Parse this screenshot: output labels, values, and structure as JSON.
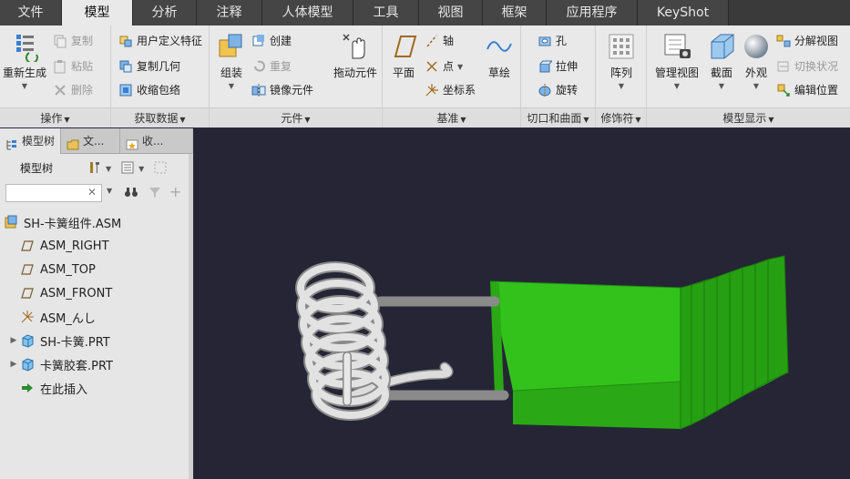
{
  "tabs": [
    "文件",
    "模型",
    "分析",
    "注释",
    "人体模型",
    "工具",
    "视图",
    "框架",
    "应用程序",
    "KeyShot"
  ],
  "active_tab": "模型",
  "ribbon": {
    "operations": {
      "label": "操作",
      "regenerate": "重新生成",
      "copy": "复制",
      "paste": "粘贴",
      "delete": "删除"
    },
    "get_data": {
      "label": "获取数据",
      "udf": "用户定义特征",
      "copy_geom": "复制几何",
      "shrinkwrap": "收缩包络"
    },
    "components": {
      "label": "元件",
      "assemble": "组装",
      "create": "创建",
      "repeat": "重复",
      "mirror": "镜像元件",
      "drag": "拖动元件"
    },
    "datum": {
      "label": "基准",
      "plane": "平面",
      "axis": "轴",
      "point": "点",
      "csys": "坐标系",
      "sketch": "草绘"
    },
    "cut_surface": {
      "label": "切口和曲面",
      "hole": "孔",
      "extrude": "拉伸",
      "revolve": "旋转"
    },
    "modifiers": {
      "label": "修饰符",
      "pattern": "阵列"
    },
    "model_display": {
      "label": "模型显示",
      "manage_views": "管理视图",
      "section": "截面",
      "appearance": "外观",
      "explode": "分解视图",
      "toggle_status": "切换状况",
      "edit_position": "编辑位置"
    }
  },
  "left_panel": {
    "tabs": [
      "模型树",
      "文...",
      "收..."
    ],
    "tree_header": "模型树",
    "search_value": "",
    "tree": [
      {
        "label": "SH-卡簧组件.ASM",
        "icon": "assembly-icon",
        "indent": 0,
        "expand": ""
      },
      {
        "label": "ASM_RIGHT",
        "icon": "datum-plane-icon",
        "indent": 1,
        "expand": ""
      },
      {
        "label": "ASM_TOP",
        "icon": "datum-plane-icon",
        "indent": 1,
        "expand": ""
      },
      {
        "label": "ASM_FRONT",
        "icon": "datum-plane-icon",
        "indent": 1,
        "expand": ""
      },
      {
        "label": "ASM_んし",
        "icon": "csys-icon",
        "indent": 1,
        "expand": ""
      },
      {
        "label": "SH-卡簧.PRT",
        "icon": "part-icon",
        "indent": 1,
        "expand": "▶"
      },
      {
        "label": "卡簧胶套.PRT",
        "icon": "part-icon",
        "indent": 1,
        "expand": "▶"
      },
      {
        "label": "在此插入",
        "icon": "insert-arrow-icon",
        "indent": 1,
        "expand": ""
      }
    ]
  },
  "colors": {
    "viewport_bg": "#252535",
    "part_green": "#2fb31a",
    "spring_gray": "#d8d8d8"
  }
}
